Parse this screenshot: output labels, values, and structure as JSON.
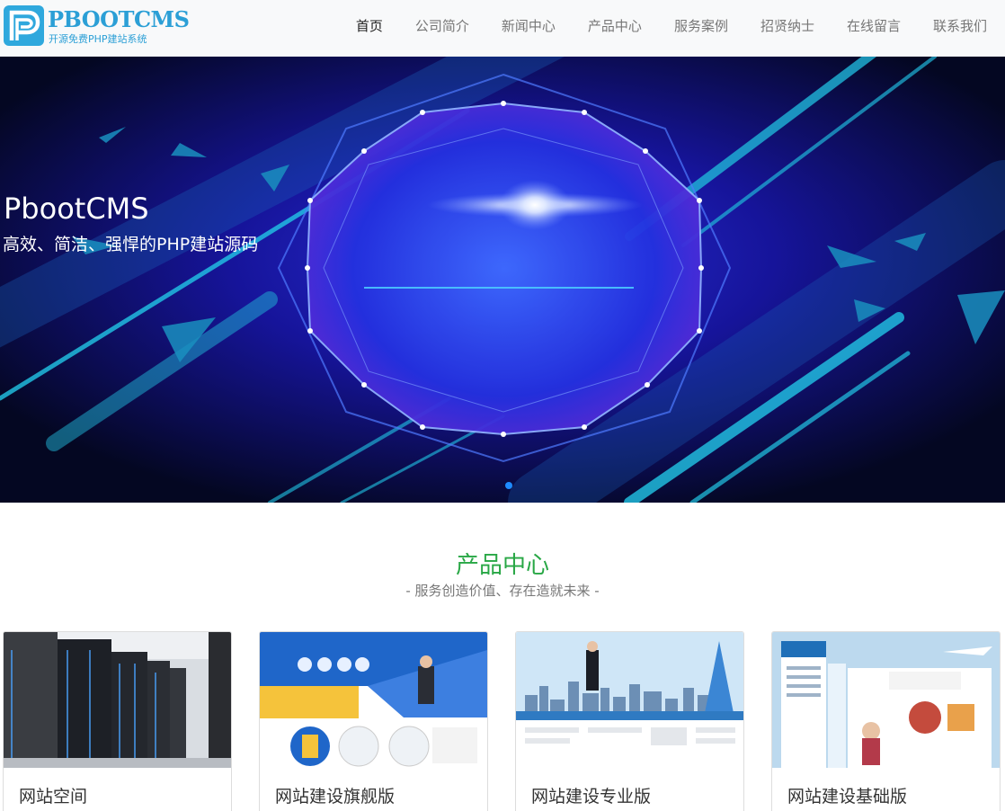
{
  "header": {
    "logo": {
      "title": "PBOOTCMS",
      "subtitle": "开源免费PHP建站系统"
    },
    "nav": [
      {
        "label": "首页",
        "active": true
      },
      {
        "label": "公司简介"
      },
      {
        "label": "新闻中心"
      },
      {
        "label": "产品中心"
      },
      {
        "label": "服务案例"
      },
      {
        "label": "招贤纳士"
      },
      {
        "label": "在线留言"
      },
      {
        "label": "联系我们"
      }
    ]
  },
  "banner": {
    "title": "PbootCMS",
    "subtitle": "高效、简洁、强悍的PHP建站源码"
  },
  "products": {
    "title": "产品中心",
    "subtitle": "- 服务创造价值、存在造就未来 -",
    "items": [
      {
        "name": "网站空间"
      },
      {
        "name": "网站建设旗舰版"
      },
      {
        "name": "网站建设专业版"
      },
      {
        "name": "网站建设基础版"
      }
    ]
  }
}
